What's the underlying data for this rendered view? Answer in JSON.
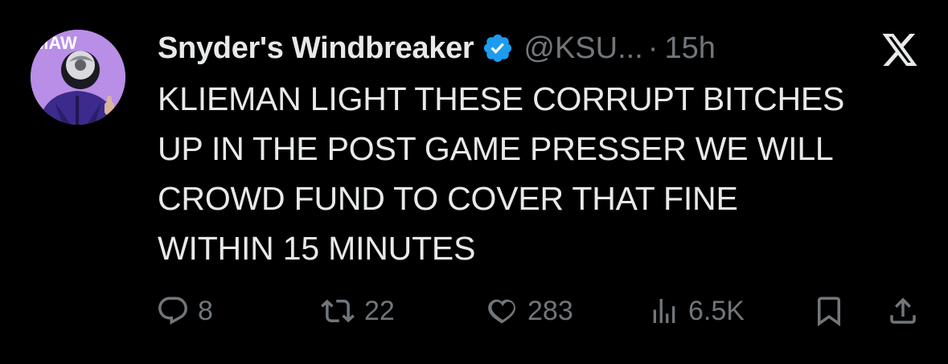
{
  "author": {
    "display_name": "Snyder's Windbreaker",
    "handle": "@KSU...",
    "separator": "·",
    "timestamp": "15h",
    "avatar_text": "MAW"
  },
  "tweet": {
    "lines": [
      "KLIEMAN LIGHT THESE CORRUPT BITCHES",
      "UP IN THE POST GAME PRESSER WE WILL",
      "CROWD FUND TO COVER THAT FINE",
      "WITHIN 15 MINUTES"
    ]
  },
  "actions": {
    "replies": "8",
    "retweets": "22",
    "likes": "283",
    "views": "6.5K"
  },
  "icons": {
    "verified": "verified-badge-icon",
    "platform": "x-logo-icon",
    "reply": "reply-icon",
    "retweet": "retweet-icon",
    "like": "heart-icon",
    "views": "views-icon",
    "bookmark": "bookmark-icon",
    "share": "share-icon"
  },
  "colors": {
    "background": "#000000",
    "text_primary": "#e7e9ea",
    "text_secondary": "#71767b",
    "verified_blue": "#1d9bf0",
    "avatar_bg": "#b88ee6"
  }
}
